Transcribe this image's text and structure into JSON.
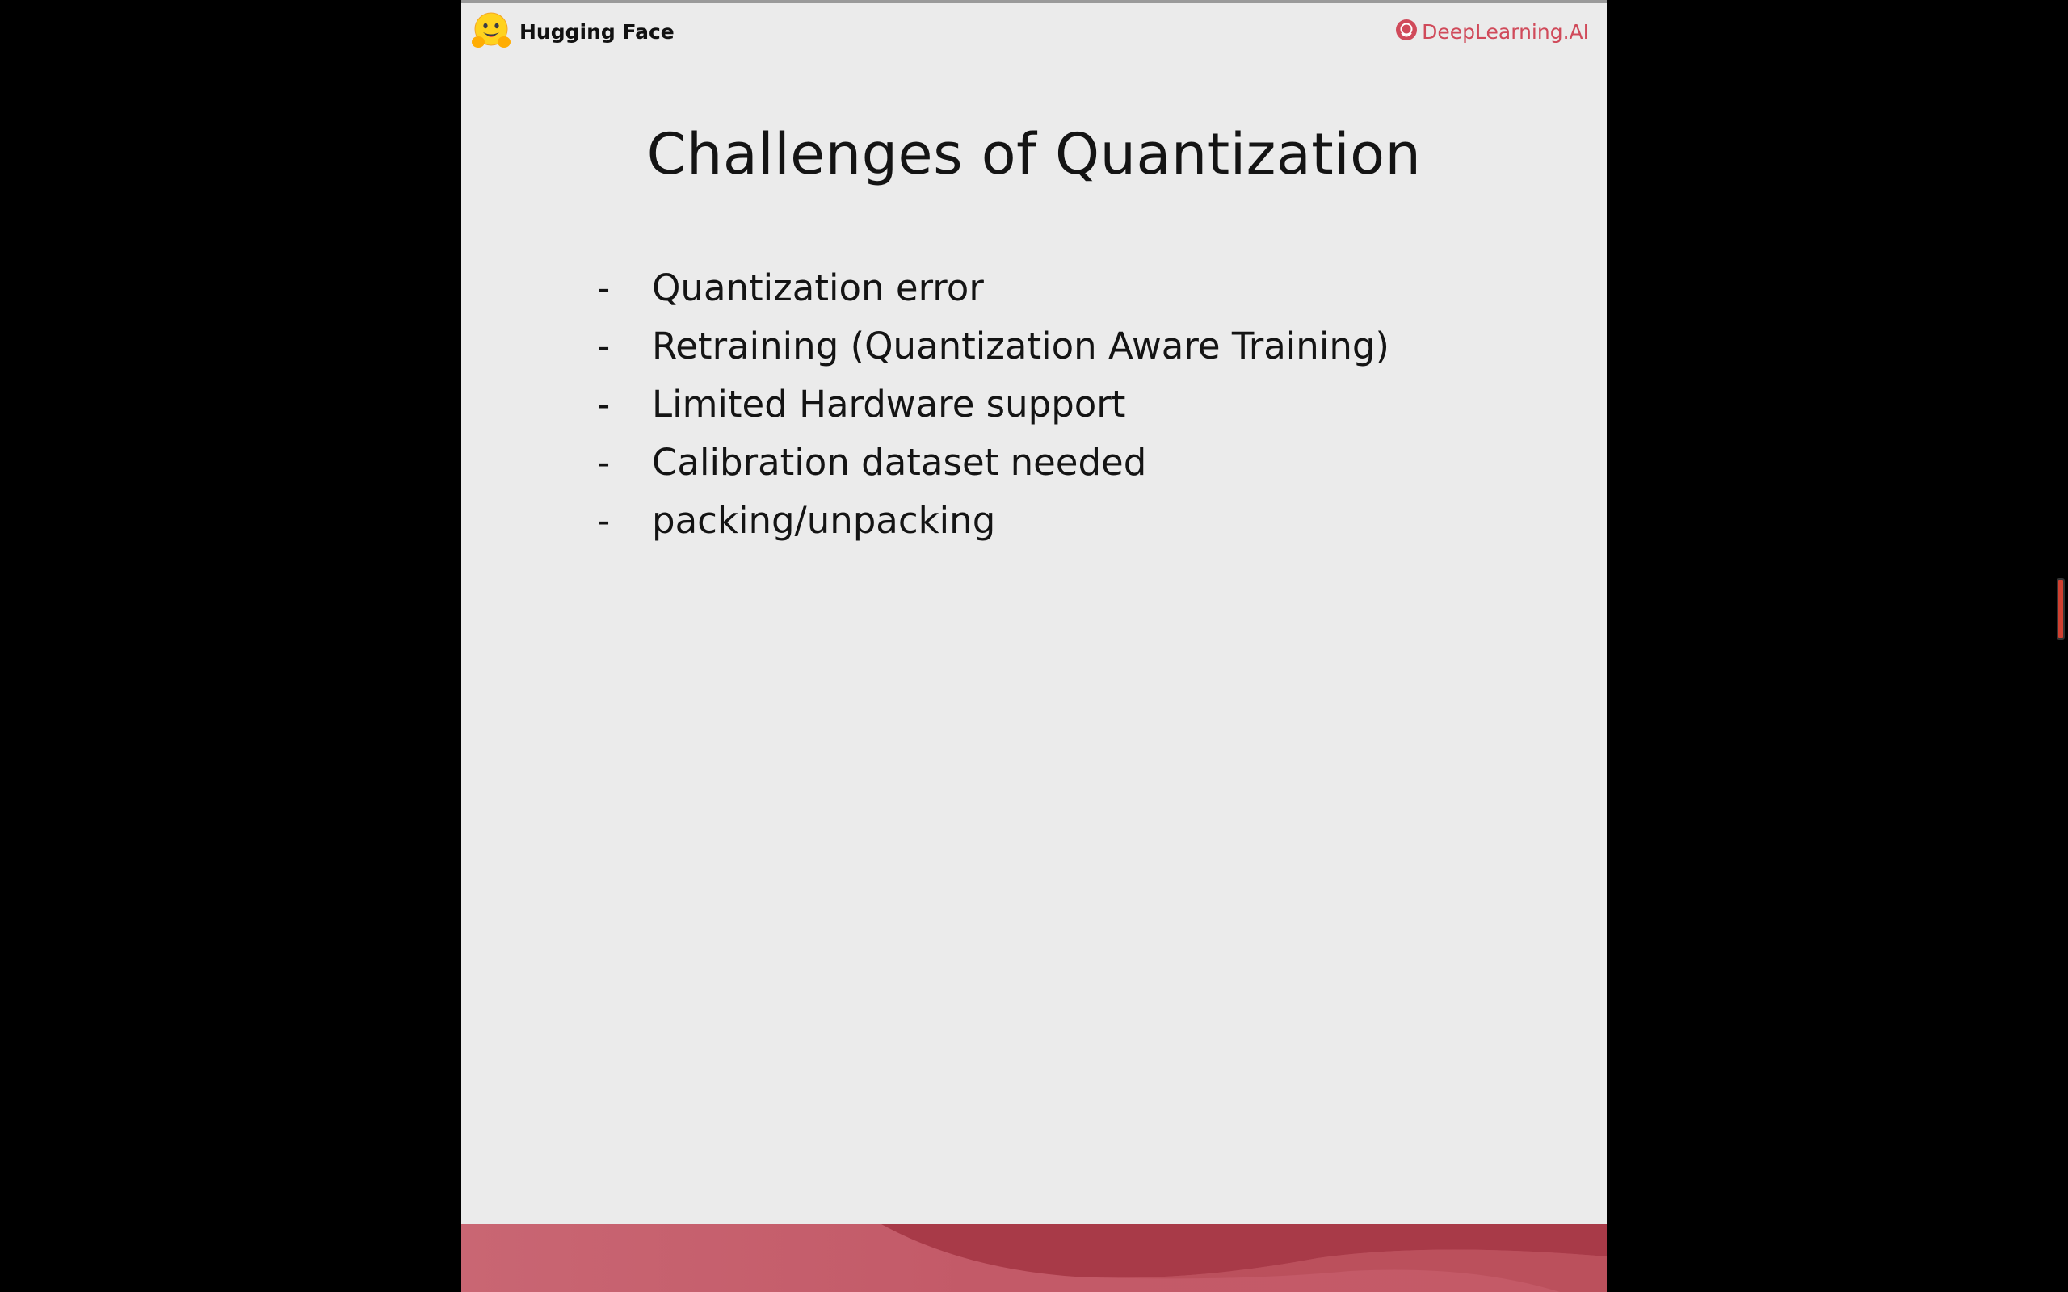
{
  "header": {
    "brand_left": "Hugging Face",
    "brand_right": "DeepLearning.AI",
    "brand_right_color": "#d04a5a",
    "left_icon": "hugging-face-emoji-icon",
    "right_icon": "deeplearning-ai-icon"
  },
  "slide": {
    "title": "Challenges of Quantization",
    "bullet_marker": "-",
    "bullets": [
      "Quantization error",
      "Retraining (Quantization Aware Training)",
      "Limited Hardware support",
      "Calibration dataset needed",
      "packing/unpacking"
    ]
  },
  "colors": {
    "slide_background": "#ebebeb",
    "footer_wave": "#a83a48",
    "footer_light": "#c9606e",
    "outer_background": "#000000"
  }
}
